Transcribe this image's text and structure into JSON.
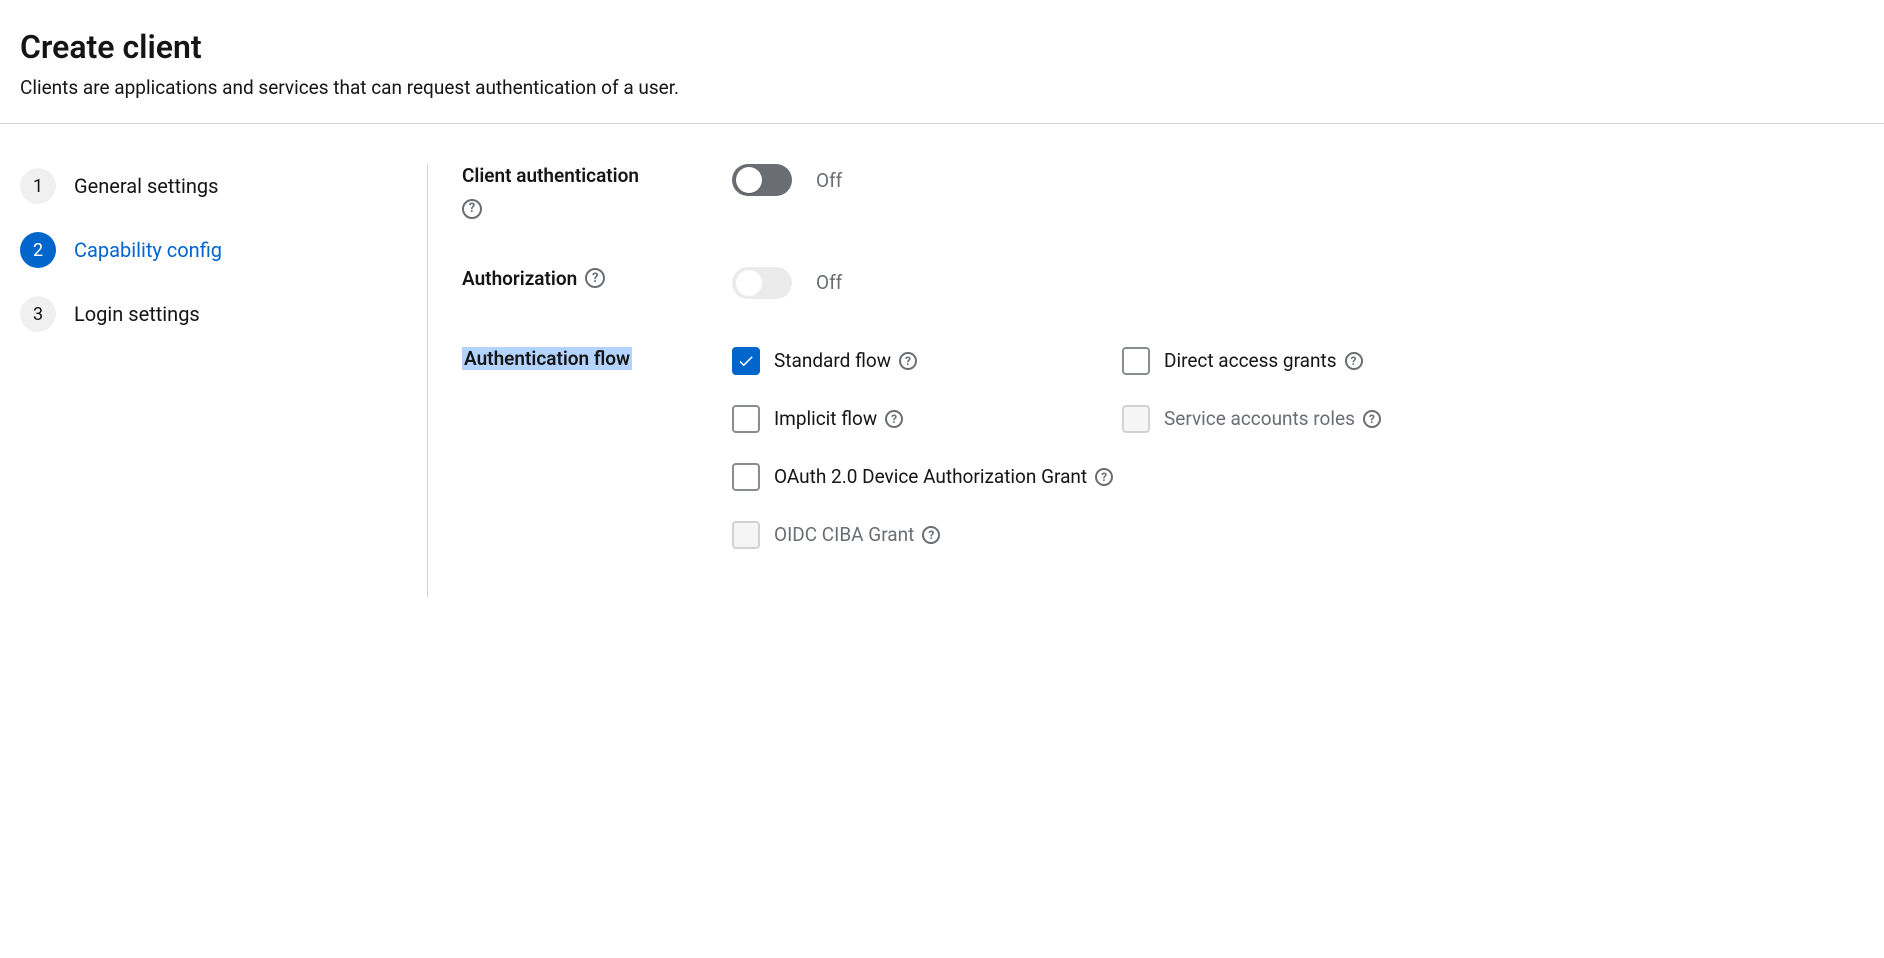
{
  "header": {
    "title": "Create client",
    "subtitle": "Clients are applications and services that can request authentication of a user."
  },
  "wizard": {
    "steps": [
      {
        "num": "1",
        "label": "General settings",
        "active": false
      },
      {
        "num": "2",
        "label": "Capability config",
        "active": true
      },
      {
        "num": "3",
        "label": "Login settings",
        "active": false
      }
    ]
  },
  "form": {
    "client_auth": {
      "label": "Client authentication",
      "state": "Off",
      "on": false,
      "disabled": false
    },
    "authorization": {
      "label": "Authorization",
      "state": "Off",
      "on": false,
      "disabled": true
    },
    "auth_flow": {
      "label": "Authentication flow",
      "options": {
        "standard": {
          "label": "Standard flow",
          "checked": true,
          "disabled": false
        },
        "direct_access": {
          "label": "Direct access grants",
          "checked": false,
          "disabled": false
        },
        "implicit": {
          "label": "Implicit flow",
          "checked": false,
          "disabled": false
        },
        "service_accounts": {
          "label": "Service accounts roles",
          "checked": false,
          "disabled": true
        },
        "oauth_device": {
          "label": "OAuth 2.0 Device Authorization Grant",
          "checked": false,
          "disabled": false
        },
        "oidc_ciba": {
          "label": "OIDC CIBA Grant",
          "checked": false,
          "disabled": true
        }
      }
    }
  }
}
